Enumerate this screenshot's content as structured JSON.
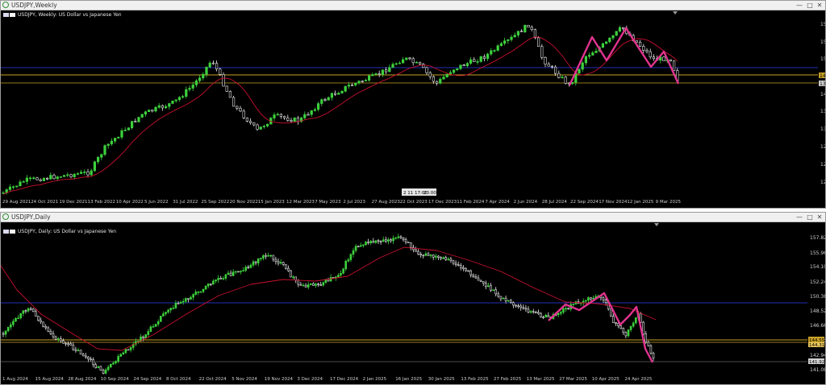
{
  "top_window": {
    "title": "USDJPY,Weekly",
    "info": "USDJPY, Weekly:  US Dollar vs Japanese Yen",
    "controls": [
      "—",
      "□",
      "✕"
    ],
    "xlabels": [
      "29 Aug 2021",
      "24 Oct 2021",
      "19 Dec 2021",
      "13 Feb 2022",
      "10 Apr 2022",
      "5 Jun 2022",
      "31 Jul 2022",
      "25 Sep 2022",
      "20 Nov 2022",
      "15 Jan 2023",
      "12 Mar 2023",
      "7 May 2023",
      "2 Jul 2023",
      "27 Aug 2023",
      "22 Oct 2023",
      "17 Dec 2023",
      "11 Feb 2024",
      "7 Apr 2024",
      "2 Jun 2024",
      "28 Jul 2024",
      "22 Sep 2024",
      "17 Nov 2024",
      "12 Jan 2025",
      "9 Mar 2025"
    ],
    "ylabels": [
      "15",
      "15",
      "15",
      "14",
      "14",
      "13",
      "13",
      "12",
      "12",
      "12",
      "11",
      "11"
    ],
    "cursor_tag": [
      "2 11 17:00",
      "20.00"
    ],
    "price_tags": [
      "14",
      "13"
    ]
  },
  "bottom_window": {
    "title": "USDJPY,Daily",
    "info": "USDJPY, Daily:  US Dollar vs Japanese Yen",
    "controls": [
      "—",
      "□",
      "✕"
    ],
    "ylabels": [
      "157.820",
      "155.960",
      "154.100",
      "152.240",
      "150.380",
      "148.520",
      "146.660",
      "144.800",
      "142.940",
      "141.080"
    ],
    "xlabels": [
      "1 Aug 2024",
      "15 Aug 2024",
      "28 Aug 2024",
      "10 Sep 2024",
      "24 Sep 2024",
      "8 Oct 2024",
      "22 Oct 2024",
      "5 Nov 2024",
      "19 Nov 2024",
      "3 Dec 2024",
      "17 Dec 2024",
      "2 Jan 2025",
      "16 Jan 2025",
      "30 Jan 2025",
      "13 Feb 2025",
      "27 Feb 2025",
      "13 Mar 2025",
      "27 Mar 2025",
      "10 Apr 2025",
      "24 Apr 2025"
    ],
    "price_tags": [
      "144.556",
      "144.312",
      "141.925"
    ]
  },
  "colors": {
    "bull": "#3dd13d",
    "bear": "#e8e8e8",
    "ma": "#c8102e",
    "pattern": "#e2338f",
    "hline_gold": "#c9a227",
    "hline_blue": "#1f2fb4"
  },
  "icons": [
    "app-logo-icon",
    "minimize-icon",
    "maximize-icon",
    "close-icon",
    "flag-icon"
  ]
}
